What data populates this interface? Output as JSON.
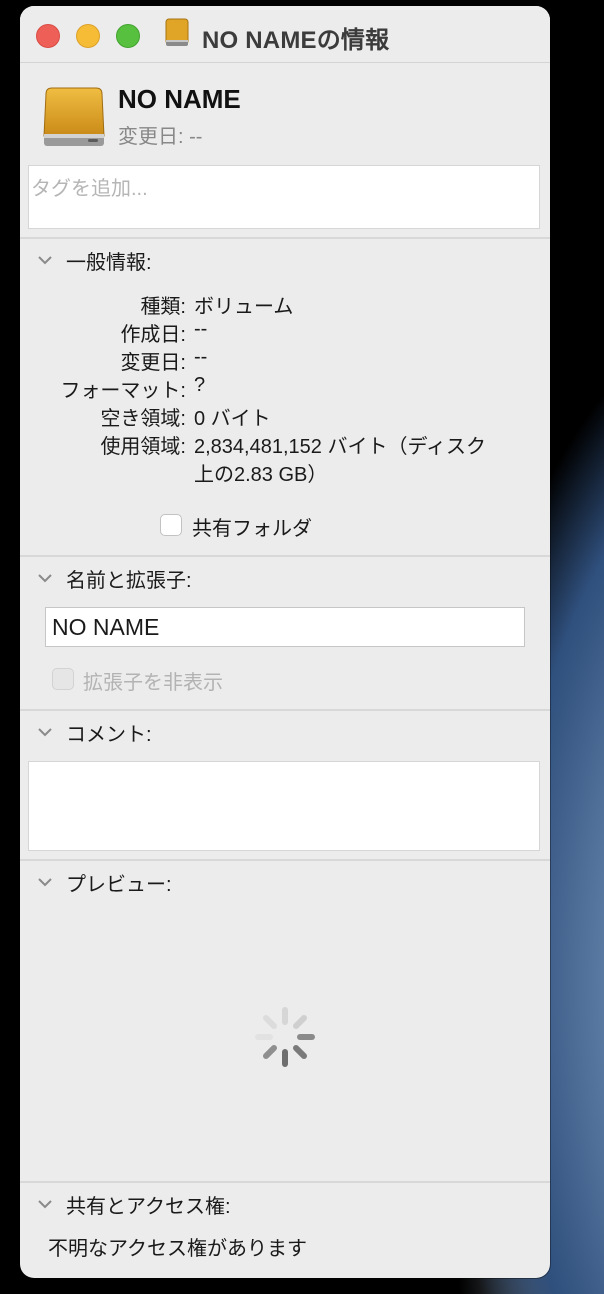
{
  "window": {
    "title": "NO NAMEの情報",
    "title_icon": "external-drive-icon"
  },
  "header": {
    "volume_name": "NO NAME",
    "modified_label": "変更日:",
    "modified_value": "--"
  },
  "tags": {
    "placeholder": "タグを追加..."
  },
  "general": {
    "header": "一般情報:",
    "rows": [
      {
        "label": "種類:",
        "value": "ボリューム"
      },
      {
        "label": "作成日:",
        "value": "--"
      },
      {
        "label": "変更日:",
        "value": "--"
      },
      {
        "label": "フォーマット:",
        "value": "?"
      },
      {
        "label": "空き領域:",
        "value": "0 バイト"
      },
      {
        "label": "使用領域:",
        "value": "2,834,481,152 バイト（ディスク",
        "value_line2": "上の2.83 GB）"
      }
    ],
    "shared_folder_label": "共有フォルダ",
    "shared_folder_checked": false
  },
  "name_ext": {
    "header": "名前と拡張子:",
    "name_value": "NO NAME",
    "hide_ext_label": "拡張子を非表示",
    "hide_ext_checked": false,
    "hide_ext_disabled": true
  },
  "comments": {
    "header": "コメント:",
    "value": ""
  },
  "preview": {
    "header": "プレビュー:",
    "state": "loading-spinner"
  },
  "sharing": {
    "header": "共有とアクセス権:",
    "status": "不明なアクセス権があります"
  },
  "colors": {
    "close": "#ee5f57",
    "minimize": "#f6bc36",
    "maximize": "#57c03f",
    "drive_body": "#e0a426",
    "window_bg": "#ececec"
  }
}
